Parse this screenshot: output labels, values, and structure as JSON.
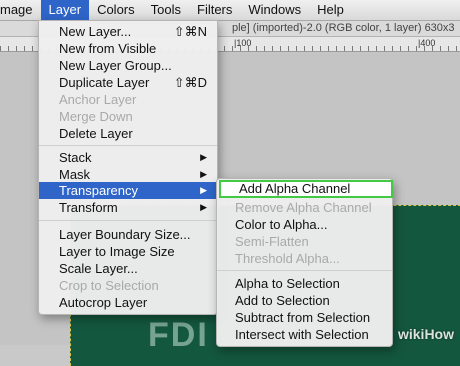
{
  "menubar": {
    "items": [
      "mage",
      "Layer",
      "Colors",
      "Tools",
      "Filters",
      "Windows",
      "Help"
    ]
  },
  "window": {
    "title": "ple] (imported)-2.0 (RGB color, 1 layer) 630x3",
    "ruler_labels": [
      "|100",
      "|400"
    ]
  },
  "canvas": {
    "text": "FDI",
    "watermark": "wikiHow"
  },
  "layer_menu": {
    "items": [
      {
        "label": "New Layer...",
        "shortcut": "⇧⌘N"
      },
      {
        "label": "New from Visible"
      },
      {
        "label": "New Layer Group..."
      },
      {
        "label": "Duplicate Layer",
        "shortcut": "⇧⌘D"
      },
      {
        "label": "Anchor Layer",
        "disabled": true
      },
      {
        "label": "Merge Down",
        "disabled": true
      },
      {
        "label": "Delete Layer"
      },
      {
        "label": "Stack",
        "submenu": "▶"
      },
      {
        "label": "Mask",
        "submenu": "▶"
      },
      {
        "label": "Transparency",
        "submenu": "▶"
      },
      {
        "label": "Transform",
        "submenu": "▶"
      },
      {
        "label": "Layer Boundary Size..."
      },
      {
        "label": "Layer to Image Size"
      },
      {
        "label": "Scale Layer..."
      },
      {
        "label": "Crop to Selection",
        "disabled": true
      },
      {
        "label": "Autocrop Layer"
      }
    ]
  },
  "transparency_menu": {
    "items": [
      {
        "label": "Add Alpha Channel"
      },
      {
        "label": "Remove Alpha Channel",
        "disabled": true
      },
      {
        "label": "Color to Alpha..."
      },
      {
        "label": "Semi-Flatten",
        "disabled": true
      },
      {
        "label": "Threshold Alpha...",
        "disabled": true
      },
      {
        "label": "Alpha to Selection"
      },
      {
        "label": "Add to Selection"
      },
      {
        "label": "Subtract from Selection"
      },
      {
        "label": "Intersect with Selection"
      }
    ]
  },
  "colors": {
    "highlight": "#2f64c8",
    "focus_border": "#44c944",
    "canvas": "#14573f"
  }
}
